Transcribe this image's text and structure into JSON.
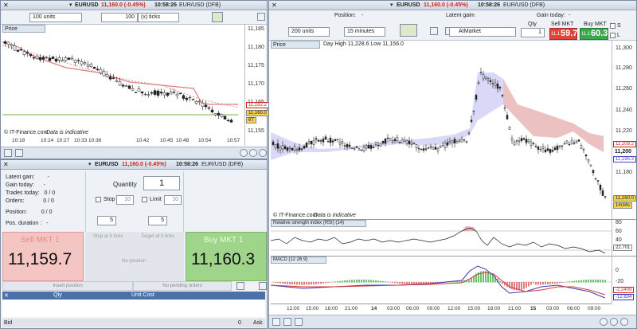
{
  "left_chart": {
    "instrument": "EURUSD",
    "quote": "11,160.0 (-0.45%)",
    "time": "10:58:26",
    "symbol": "EUR/USD (DFB)",
    "units": "100 units",
    "tick_value": "100",
    "ticks_label": "(x) ticks",
    "price_tab": "Price",
    "watermark": "© IT-Finance.com",
    "indicative": "Data is indicative",
    "y_ticks": [
      "11,185",
      "11,180",
      "11,175",
      "11,170",
      "11,165",
      "11,160",
      "11,155"
    ],
    "price_tag": "11,160.0",
    "price_tag_sub": "6T",
    "upper_tag": "11,162.2",
    "x_ticks": [
      "10:18",
      "10:24",
      "10:27",
      "10:33",
      "10:36",
      "10:42",
      "10:45",
      "10:48",
      "10:54",
      "10:57"
    ]
  },
  "trade_panel": {
    "instrument": "EURUSD",
    "quote": "11,160.0 (-0.45%)",
    "time": "10:58:26",
    "symbol": "EUR/USD (DFB)",
    "latent_gain_label": "Latent gain:",
    "latent_gain_value": "-",
    "gain_today_label": "Gain today:",
    "gain_today_value": "-",
    "trades_today_label": "Trades today:",
    "trades_today_value": "0 / 0",
    "orders_label": "Orders:",
    "orders_value_a": "0",
    "orders_value_b": "0",
    "position_label": "Position:",
    "position_value_a": "0",
    "position_value_b": "0",
    "pos_duration_label": "Pos. duration :",
    "pos_duration_value": "-",
    "quantity_label": "Quantity",
    "quantity_value": "1",
    "stop_label": "Stop",
    "stop_value": "10",
    "limit_label": "Limit",
    "limit_value": "10",
    "stop_ticks": "5",
    "limit_ticks": "5",
    "stop_at_label": "Stop at 5 ticks",
    "target_label": "Target at 5 ticks",
    "no_position": "No position",
    "sell_label": "Sell MKT 1",
    "sell_price": "11,159.7",
    "buy_label": "Buy MKT 1",
    "buy_price": "11,160.3",
    "insert_position": "Insert position",
    "no_pending": "No pending orders",
    "col_qty": "Qty",
    "col_unit_cost": "Unit Cost",
    "bid_label": "Bid",
    "bid_value": "0",
    "ask_label": "Ask",
    "ask_value": "0"
  },
  "right_chart": {
    "instrument": "EURUSD",
    "quote": "11,160.0 (-0.45%)",
    "time": "10:58:26",
    "symbol": "EUR/USD (DFB)",
    "position_label": "Position:",
    "position_value": "-",
    "latent_gain_label": "Latent gain:",
    "latent_gain_value": "-",
    "gain_today_label": "Gain today:",
    "gain_today_value": "-",
    "units": "200 units",
    "interval": "15 minutes",
    "order_type": "AtMarket",
    "qty_label": "Qty",
    "qty_value": "1",
    "sell_label": "Sell MKT",
    "sell_small": "11,1",
    "sell_big": "59.7",
    "buy_label": "Buy MKT",
    "buy_small": "11,1",
    "buy_big": "60.3",
    "s_label": "S",
    "l_label": "L",
    "price_tab": "Price",
    "day_info": "Day High 11,228.6 Low 11,156.0",
    "watermark": "© IT-Finance.com",
    "indicative": "Data is indicative",
    "y_ticks": [
      "11,300",
      "11,280",
      "11,260",
      "11,240",
      "11,220",
      "11,200",
      "11,180"
    ],
    "tag_upper": "11,209.2",
    "tag_lower": "11,195.3",
    "tag_200": "11,200",
    "price_tag": "11,160.0",
    "price_tag_sub": "1m34s",
    "rsi_title": "Relative strength index (RSI) (14)",
    "rsi_ticks": [
      "80",
      "60",
      "40",
      "20"
    ],
    "rsi_tag": "22.701",
    "macd_title": "MACD (12 26 9)",
    "macd_ticks": [
      "0",
      "-20",
      "-40"
    ],
    "macd_tag1": "-2.2409",
    "macd_tag2": "-12.834",
    "x_ticks": [
      "12:00",
      "15:00",
      "18:00",
      "21:00",
      "14",
      "03:00",
      "06:00",
      "09:00",
      "12:00",
      "15:00",
      "18:00",
      "21:00",
      "15",
      "03:00",
      "06:00",
      "09:00"
    ]
  }
}
